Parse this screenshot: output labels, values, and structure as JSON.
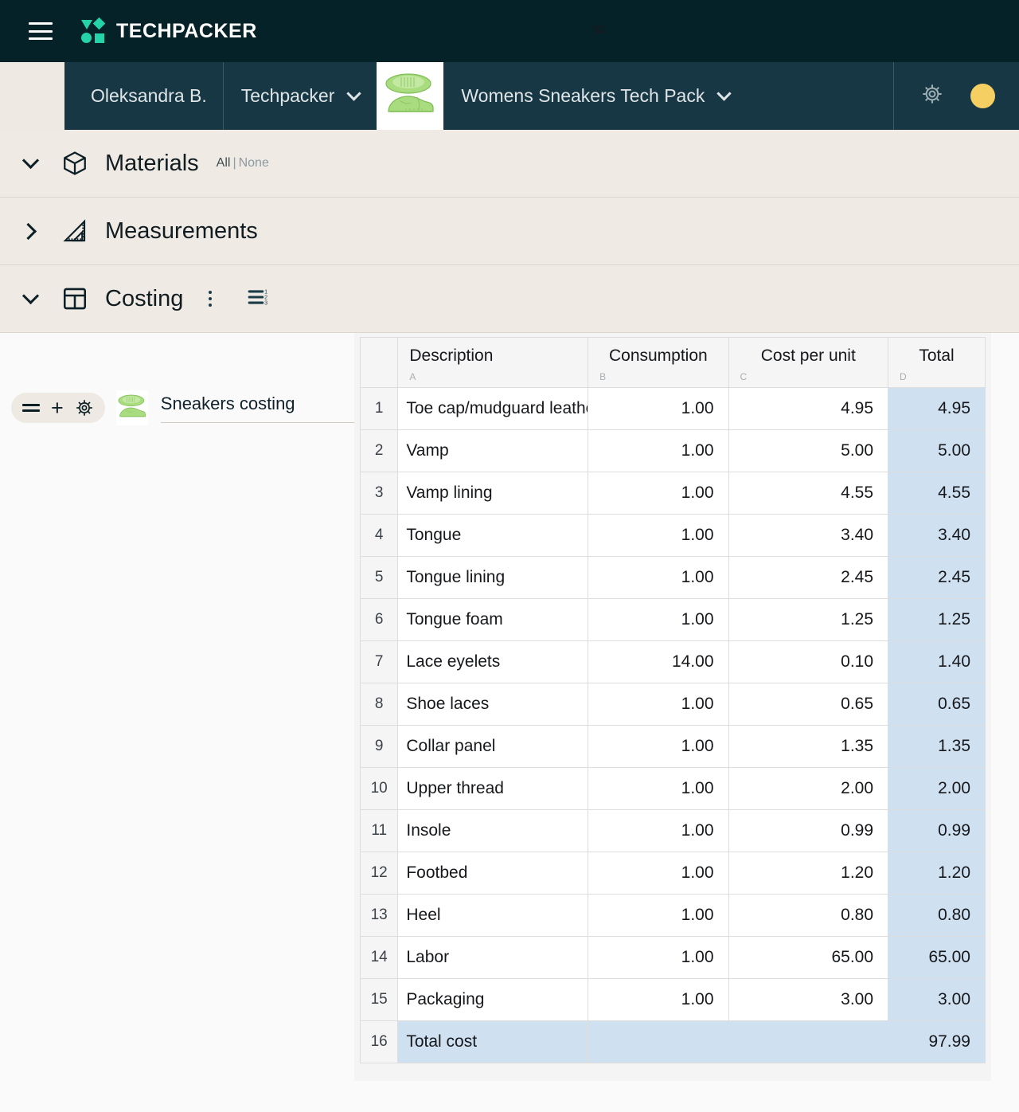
{
  "brand": {
    "name": "TECHPACKER",
    "menu_icon": "hamburger-icon",
    "logo_icon": "techpacker-logo-icon",
    "ghost_text": "w"
  },
  "navbar": {
    "user": "Oleksandra B.",
    "workspace": "Techpacker",
    "project": "Womens Sneakers Tech Pack",
    "thumbnail_icon": "sneaker-thumbnail-icon",
    "settings_icon": "gear-icon",
    "avatar_icon": "user-avatar"
  },
  "sections": [
    {
      "id": "materials",
      "title": "Materials",
      "icon": "cube-icon",
      "expanded": true,
      "select_all": "All",
      "select_pipe": "|",
      "select_none": "None"
    },
    {
      "id": "measurements",
      "title": "Measurements",
      "icon": "set-square-ruler-icon",
      "expanded": false
    },
    {
      "id": "costing",
      "title": "Costing",
      "icon": "layout-panel-icon",
      "expanded": true,
      "more_icon": "more-vertical-icon",
      "numbered_list_icon": "numbered-list-icon"
    }
  ],
  "card": {
    "drag_icon": "drag-handle-icon",
    "add_icon": "plus-icon",
    "settings_icon": "gear-icon",
    "thumbnail_icon": "sneaker-thumbnail-icon",
    "label": "Sneakers costing"
  },
  "colors": {
    "brandbar_bg": "#052229",
    "navbar_dark_bg": "#163743",
    "section_bg": "#efebe4",
    "accent_teal": "#25d3a8",
    "total_cell_bg": "#cfe0f0",
    "avatar": "#f5cf62"
  },
  "chart_data": {
    "type": "table",
    "title": "Sneakers costing",
    "columns": [
      {
        "label": "Description",
        "letter": "A"
      },
      {
        "label": "Consumption",
        "letter": "B"
      },
      {
        "label": "Cost per unit",
        "letter": "C"
      },
      {
        "label": "Total",
        "letter": "D"
      }
    ],
    "rows": [
      {
        "n": "1",
        "description": "Toe cap/mudguard leather",
        "consumption": "1.00",
        "cost": "4.95",
        "total": "4.95"
      },
      {
        "n": "2",
        "description": "Vamp",
        "consumption": "1.00",
        "cost": "5.00",
        "total": "5.00"
      },
      {
        "n": "3",
        "description": "Vamp lining",
        "consumption": "1.00",
        "cost": "4.55",
        "total": "4.55"
      },
      {
        "n": "4",
        "description": "Tongue",
        "consumption": "1.00",
        "cost": "3.40",
        "total": "3.40"
      },
      {
        "n": "5",
        "description": "Tongue lining",
        "consumption": "1.00",
        "cost": "2.45",
        "total": "2.45"
      },
      {
        "n": "6",
        "description": "Tongue foam",
        "consumption": "1.00",
        "cost": "1.25",
        "total": "1.25"
      },
      {
        "n": "7",
        "description": "Lace eyelets",
        "consumption": "14.00",
        "cost": "0.10",
        "total": "1.40"
      },
      {
        "n": "8",
        "description": "Shoe laces",
        "consumption": "1.00",
        "cost": "0.65",
        "total": "0.65"
      },
      {
        "n": "9",
        "description": "Collar panel",
        "consumption": "1.00",
        "cost": "1.35",
        "total": "1.35"
      },
      {
        "n": "10",
        "description": "Upper thread",
        "consumption": "1.00",
        "cost": "2.00",
        "total": "2.00"
      },
      {
        "n": "11",
        "description": "Insole",
        "consumption": "1.00",
        "cost": "0.99",
        "total": "0.99"
      },
      {
        "n": "12",
        "description": "Footbed",
        "consumption": "1.00",
        "cost": "1.20",
        "total": "1.20"
      },
      {
        "n": "13",
        "description": "Heel",
        "consumption": "1.00",
        "cost": "0.80",
        "total": "0.80"
      },
      {
        "n": "14",
        "description": "Labor",
        "consumption": "1.00",
        "cost": "65.00",
        "total": "65.00"
      },
      {
        "n": "15",
        "description": "Packaging",
        "consumption": "1.00",
        "cost": "3.00",
        "total": "3.00"
      },
      {
        "n": "16",
        "description": "Total cost",
        "consumption": "",
        "cost": "",
        "total": "97.99",
        "is_total": true
      }
    ]
  }
}
